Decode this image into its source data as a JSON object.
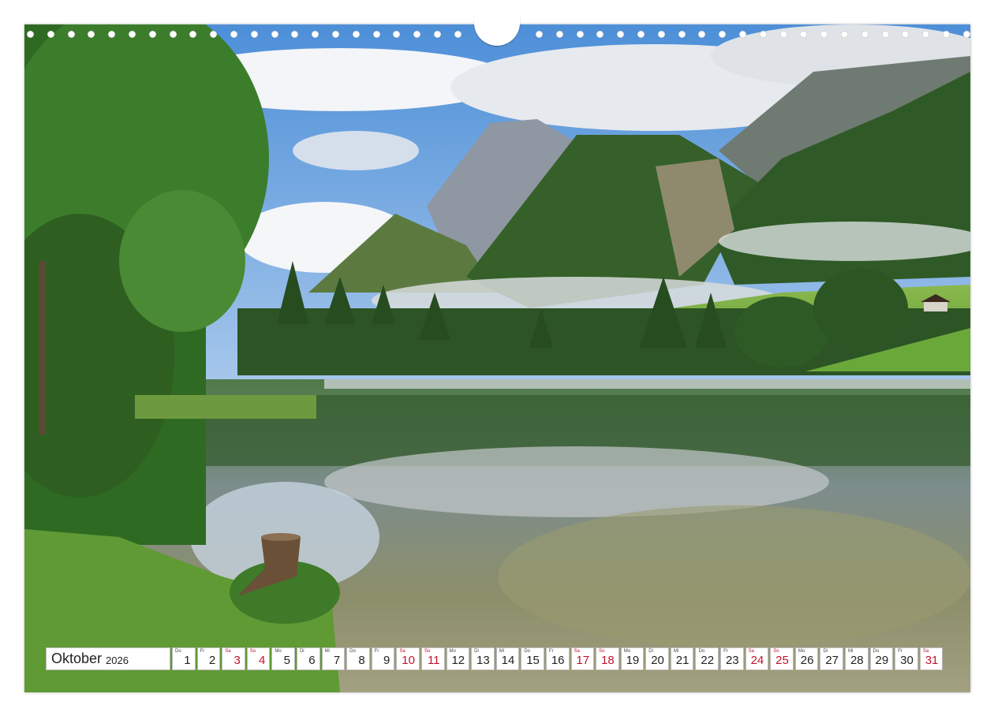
{
  "calendar": {
    "month": "Oktober",
    "year": "2026",
    "days": [
      {
        "wd": "Do",
        "num": "1",
        "weekend": false
      },
      {
        "wd": "Fr",
        "num": "2",
        "weekend": false
      },
      {
        "wd": "Sa",
        "num": "3",
        "weekend": true
      },
      {
        "wd": "So",
        "num": "4",
        "weekend": true
      },
      {
        "wd": "Mo",
        "num": "5",
        "weekend": false
      },
      {
        "wd": "Di",
        "num": "6",
        "weekend": false
      },
      {
        "wd": "Mi",
        "num": "7",
        "weekend": false
      },
      {
        "wd": "Do",
        "num": "8",
        "weekend": false
      },
      {
        "wd": "Fr",
        "num": "9",
        "weekend": false
      },
      {
        "wd": "Sa",
        "num": "10",
        "weekend": true
      },
      {
        "wd": "So",
        "num": "11",
        "weekend": true
      },
      {
        "wd": "Mo",
        "num": "12",
        "weekend": false
      },
      {
        "wd": "Di",
        "num": "13",
        "weekend": false
      },
      {
        "wd": "Mi",
        "num": "14",
        "weekend": false
      },
      {
        "wd": "Do",
        "num": "15",
        "weekend": false
      },
      {
        "wd": "Fr",
        "num": "16",
        "weekend": false
      },
      {
        "wd": "Sa",
        "num": "17",
        "weekend": true
      },
      {
        "wd": "So",
        "num": "18",
        "weekend": true
      },
      {
        "wd": "Mo",
        "num": "19",
        "weekend": false
      },
      {
        "wd": "Di",
        "num": "20",
        "weekend": false
      },
      {
        "wd": "Mi",
        "num": "21",
        "weekend": false
      },
      {
        "wd": "Do",
        "num": "22",
        "weekend": false
      },
      {
        "wd": "Fr",
        "num": "23",
        "weekend": false
      },
      {
        "wd": "Sa",
        "num": "24",
        "weekend": true
      },
      {
        "wd": "So",
        "num": "25",
        "weekend": true
      },
      {
        "wd": "Mo",
        "num": "26",
        "weekend": false
      },
      {
        "wd": "Di",
        "num": "27",
        "weekend": false
      },
      {
        "wd": "Mi",
        "num": "28",
        "weekend": false
      },
      {
        "wd": "Do",
        "num": "29",
        "weekend": false
      },
      {
        "wd": "Fr",
        "num": "30",
        "weekend": false
      },
      {
        "wd": "Sa",
        "num": "31",
        "weekend": true
      }
    ]
  },
  "colors": {
    "weekend": "#c0122c",
    "sky": "#5a9be0",
    "forest": "#2f5e24",
    "meadow": "#7fb347",
    "water": "#5d7f6a"
  },
  "icons": [
    "binding-hole-icon",
    "hanger-notch-icon"
  ]
}
